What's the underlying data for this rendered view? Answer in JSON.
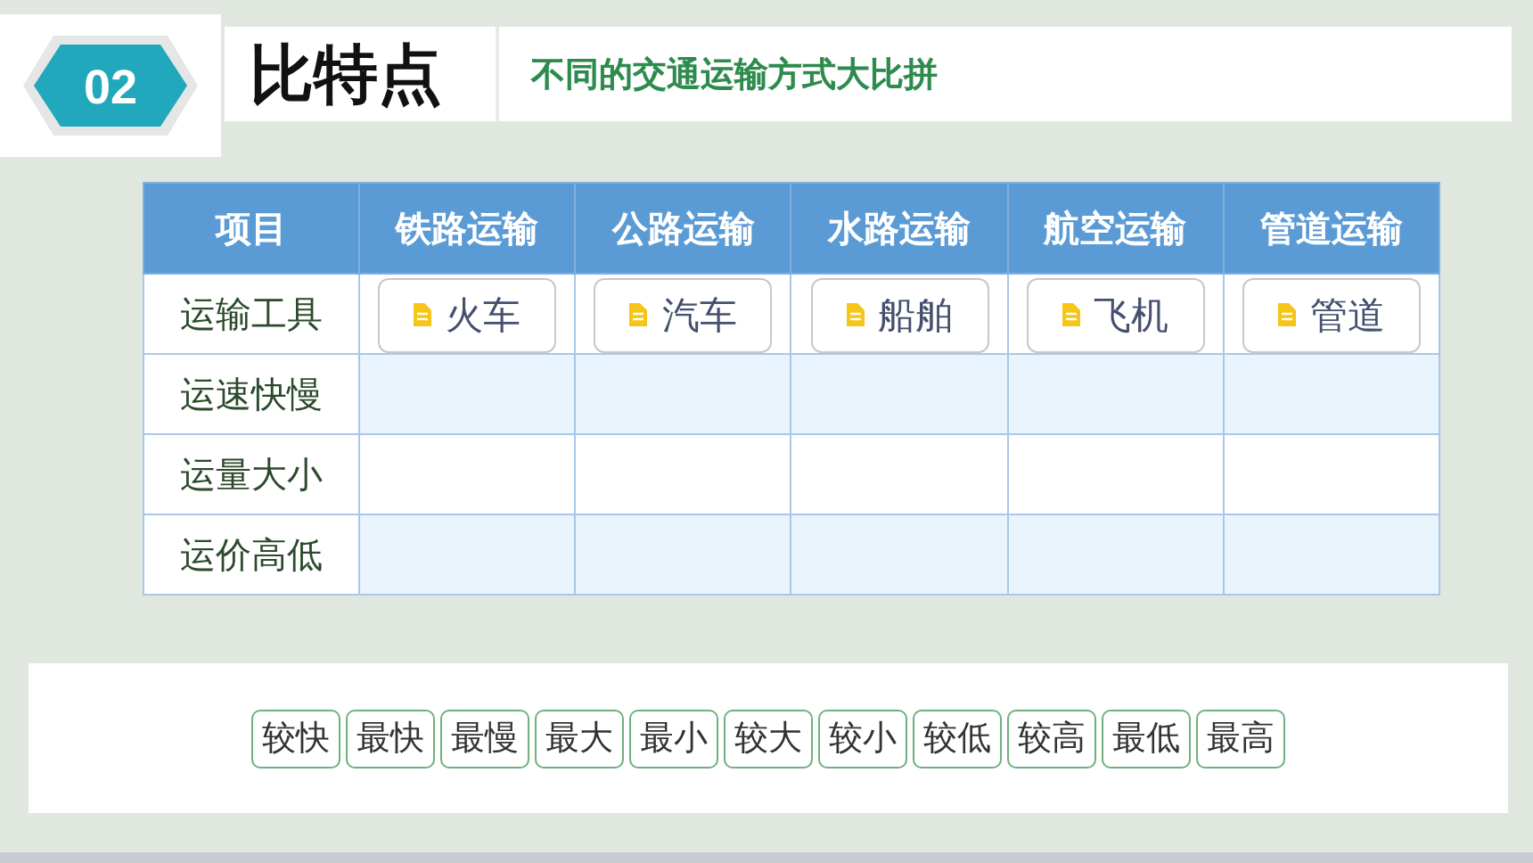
{
  "header": {
    "badge": "02",
    "title": "比特点",
    "subtitle": "不同的交通运输方式大比拼"
  },
  "table": {
    "columns": [
      "项目",
      "铁路运输",
      "公路运输",
      "水路运输",
      "航空运输",
      "管道运输"
    ],
    "rows": [
      {
        "label": "运输工具",
        "chips": [
          "火车",
          "汽车",
          "船舶",
          "飞机",
          "管道"
        ]
      },
      {
        "label": "运速快慢"
      },
      {
        "label": "运量大小"
      },
      {
        "label": "运价高低"
      }
    ]
  },
  "tags": [
    "较快",
    "最快",
    "最慢",
    "最大",
    "最小",
    "较大",
    "较小",
    "较低",
    "较高",
    "最低",
    "最高"
  ]
}
